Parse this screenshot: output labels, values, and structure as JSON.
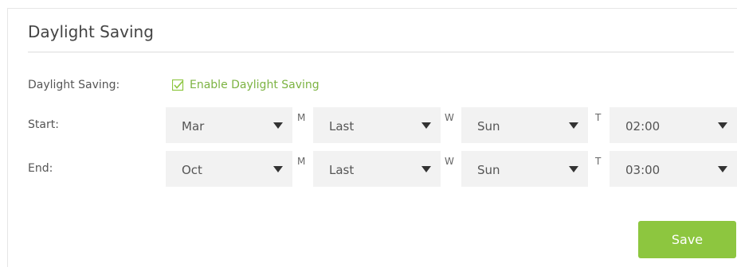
{
  "section": {
    "title": "Daylight Saving"
  },
  "enable_row": {
    "label": "Daylight Saving:",
    "checkbox_label": "Enable Daylight Saving",
    "checked": true
  },
  "start_row": {
    "label": "Start:",
    "month": "Mar",
    "week": "Last",
    "day": "Sun",
    "time": "02:00"
  },
  "end_row": {
    "label": "End:",
    "month": "Oct",
    "week": "Last",
    "day": "Sun",
    "time": "03:00"
  },
  "separators": {
    "month": "M",
    "week": "W",
    "time": "T"
  },
  "actions": {
    "save_label": "Save"
  },
  "colors": {
    "accent": "#8dc63f",
    "checkbox_label": "#7cb342",
    "select_bg": "#f2f2f2"
  },
  "icons": {
    "checkbox": "checkbox-checked-icon",
    "dropdown": "triangle-down-icon"
  }
}
